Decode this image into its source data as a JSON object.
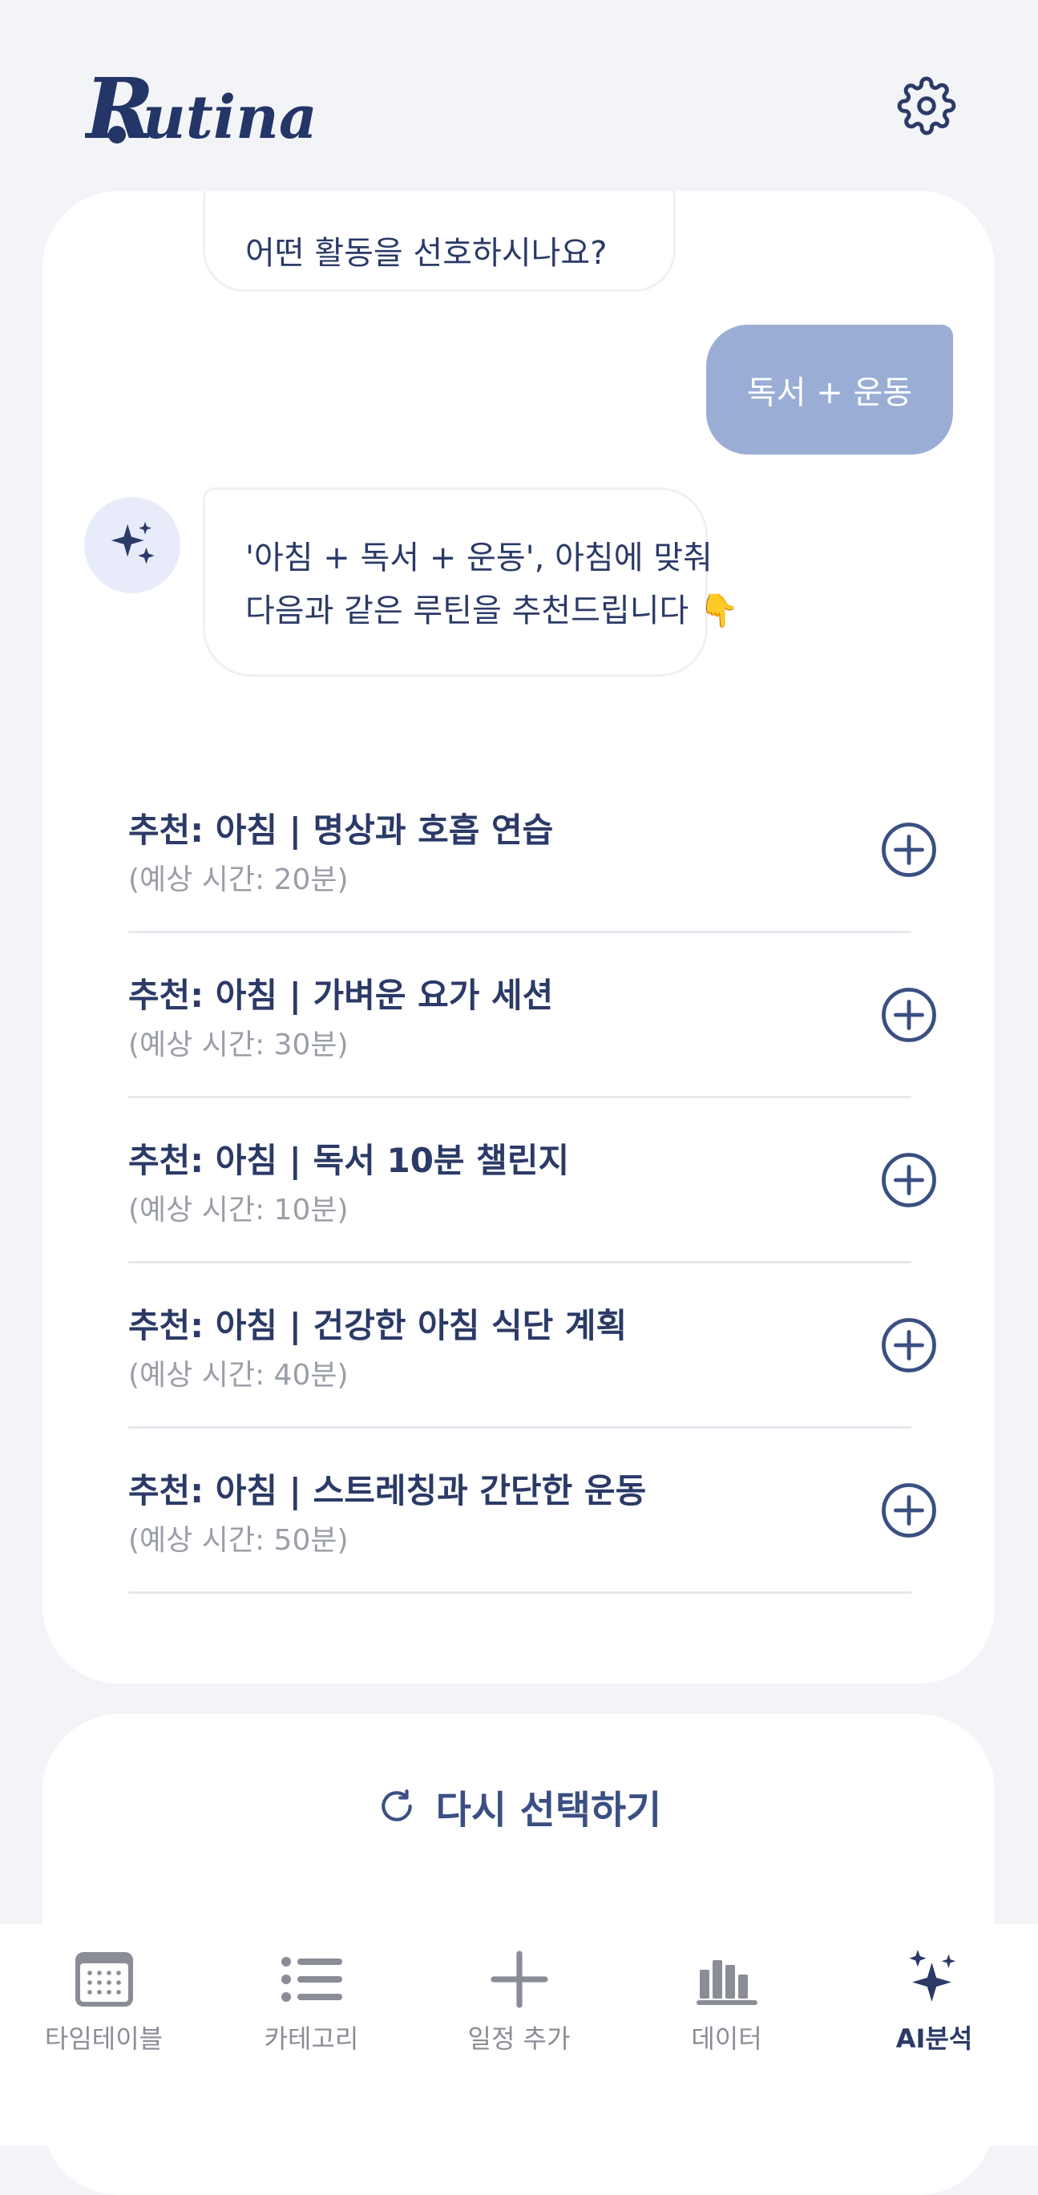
{
  "header": {
    "logo_text": "Rutina",
    "settings_icon": "gear-icon"
  },
  "chat": {
    "question": "어떤 활동을 선호하시나요?",
    "user_reply": "독서 + 운동",
    "ai_message_line1": "'아침 + 독서 + 운동', 아침에 맞춰",
    "ai_message_line2": "다음과 같은 루틴을 추천드립니다 👇",
    "ai_avatar_icon": "sparkles-icon"
  },
  "recommendations": [
    {
      "title": "추천: 아침 | 명상과 호흡 연습",
      "time": "(예상 시간: 20분)"
    },
    {
      "title": "추천: 아침 | 가벼운 요가 세션",
      "time": "(예상 시간: 30분)"
    },
    {
      "title": "추천: 아침 | 독서 10분 챌린지",
      "time": "(예상 시간: 10분)"
    },
    {
      "title": "추천: 아침 | 건강한 아침 식단 계획",
      "time": "(예상 시간: 40분)"
    },
    {
      "title": "추천: 아침 | 스트레칭과 간단한 운동",
      "time": "(예상 시간: 50분)"
    }
  ],
  "retry": {
    "label": "다시 선택하기",
    "icon": "refresh-icon"
  },
  "tabbar": {
    "items": [
      {
        "label": "타임테이블",
        "icon": "calendar-icon"
      },
      {
        "label": "카테고리",
        "icon": "list-icon"
      },
      {
        "label": "일정 추가",
        "icon": "plus-icon"
      },
      {
        "label": "데이터",
        "icon": "bar-chart-icon"
      },
      {
        "label": "AI분석",
        "icon": "sparkles-icon"
      }
    ],
    "active_index": 4
  },
  "colors": {
    "primary": "#2b3a67",
    "user_bubble": "#9aaed5",
    "background": "#f3f4f8",
    "muted": "#9a9ea8"
  }
}
